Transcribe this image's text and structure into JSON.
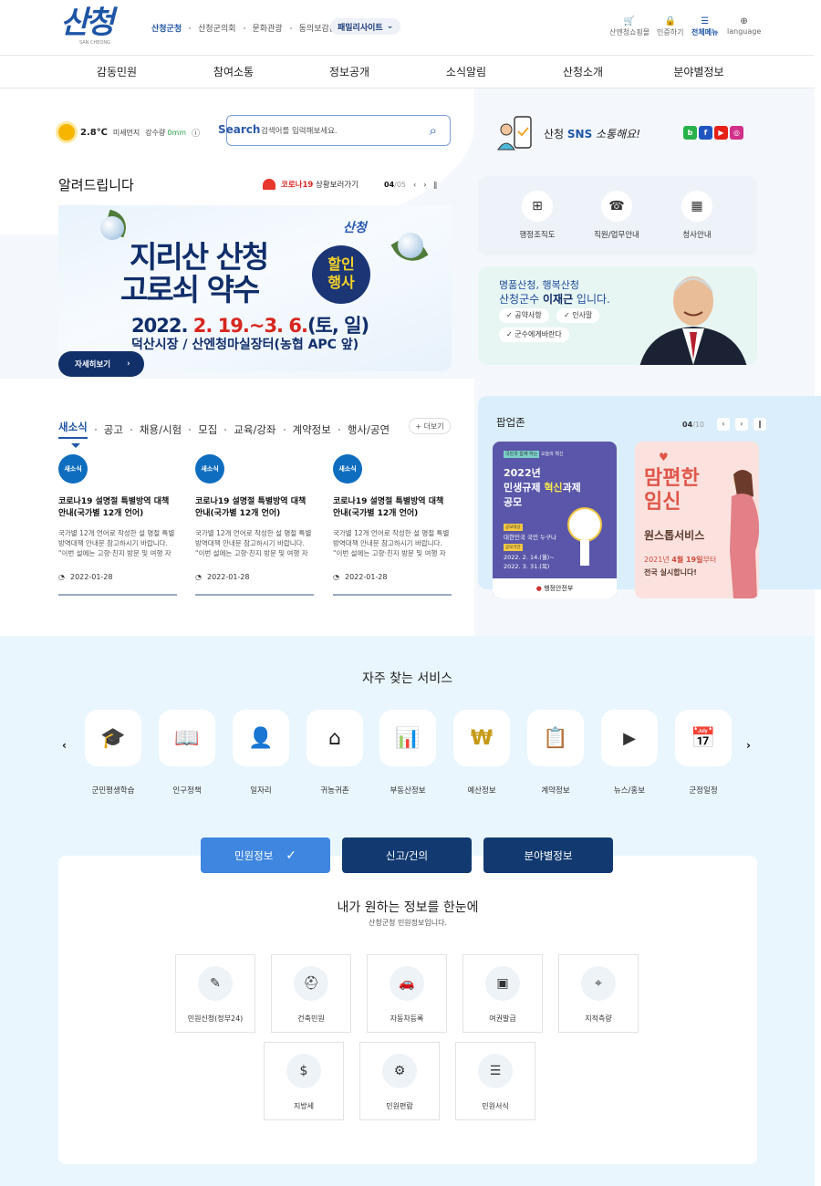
{
  "header": {
    "logo": "산청",
    "logo_sub": "SAN CHEONG",
    "toplinks": [
      "산청군청",
      "산청군의회",
      "문화관광",
      "동의보감촌"
    ],
    "family_site": "패밀리사이트",
    "util": [
      {
        "label": "산엔청쇼핑몰",
        "icon": "cart-icon"
      },
      {
        "label": "인증하기",
        "icon": "lock-icon"
      },
      {
        "label": "전체메뉴",
        "icon": "menu-icon"
      },
      {
        "label": "language",
        "icon": "globe-icon"
      }
    ]
  },
  "gnb": [
    "감동민원",
    "참여소통",
    "정보공개",
    "소식알림",
    "산청소개",
    "분야별정보"
  ],
  "weather": {
    "temp": "2.8℃",
    "dust": "미세먼지",
    "rain_label": "강수량",
    "rain": "0mm"
  },
  "search": {
    "label": "Search",
    "placeholder": "검색어를 입력해보세요."
  },
  "notice": {
    "title": "알려드립니다",
    "covid": "코로나19",
    "covid_rest": "상황보러가기",
    "page": "04",
    "total": "/05"
  },
  "banner": {
    "logo": "산청",
    "line1": "지리산 산청",
    "line2": "고로쇠 약수",
    "badge1": "할인",
    "badge2": "행사",
    "date_a": "2022. ",
    "date_b": "2. 19.~3. 6.",
    "date_c": "(토, 일)",
    "place": "덕산시장 / 산엔청마실장터(농협 APC 앞)",
    "more": "자세히보기"
  },
  "sns": {
    "text1": "산청 ",
    "text2": "SNS",
    "text3": " 소통해요!",
    "icons": [
      {
        "l": "b",
        "c": "#27b24a"
      },
      {
        "l": "f",
        "c": "#1f55c0"
      },
      {
        "l": "▶",
        "c": "#e62117"
      },
      {
        "l": "◎",
        "c": "#d1308a"
      }
    ]
  },
  "quick": [
    {
      "label": "행정조직도",
      "icon": "org-chart-icon",
      "g": "⊞"
    },
    {
      "label": "직원/업무안내",
      "icon": "phone-icon",
      "g": "☎"
    },
    {
      "label": "청사안내",
      "icon": "building-icon",
      "g": "▦"
    }
  ],
  "mayor": {
    "line1": "명품산청, 행복산청",
    "line2a": "산청군수 ",
    "line2b": "이재근",
    "line2c": " 입니다.",
    "btns": [
      "공약사항",
      "인사말",
      "군수에게바란다"
    ]
  },
  "news": {
    "tabs": [
      "새소식",
      "공고",
      "채용/시험",
      "모집",
      "교육/강좌",
      "계약정보",
      "행사/공연"
    ],
    "more": "+ 더보기",
    "cards": [
      {
        "badge": "새소식",
        "title": "코로나19 설명절 특별방역 대책 안내(국가별 12개 언어)",
        "body": "국가별 12개 언어로 작성한 설 명절 특별방역대책 안내문 참고하시기 바랍니다. \"이번 설에는 고향·친지 방문 및 여행 자제\"",
        "date": "2022-01-28"
      },
      {
        "badge": "새소식",
        "title": "코로나19 설명절 특별방역 대책 안내(국가별 12개 언어)",
        "body": "국가별 12개 언어로 작성한 설 명절 특별방역대책 안내문 참고하시기 바랍니다. \"이번 설에는 고향·친지 방문 및 여행 자제\"",
        "date": "2022-01-28"
      },
      {
        "badge": "새소식",
        "title": "코로나19 설명절 특별방역 대책 안내(국가별 12개 언어)",
        "body": "국가별 12개 언어로 작성한 설 명절 특별방역대책 안내문 참고하시기 바랍니다. \"이번 설에는 고향·친지 방문 및 여행 자제\"",
        "date": "2022-01-28"
      }
    ]
  },
  "popup": {
    "title": "팝업존",
    "page": "04",
    "total": "/10",
    "p1": {
      "tag": "국민과 함께 하는",
      "tag2": "오늘의 혁신",
      "year": "2022년",
      "l1": "민생규제 ",
      "l1b": "혁신",
      "l1c": "과제",
      "l2": "공모",
      "k1": "공모대상",
      "v1": "대한민국 국민 누구나",
      "k2": "공모기간",
      "v2": "2022. 2. 14.(월)~",
      "v3": "2022. 3. 31.(목)",
      "org": "행정안전부"
    },
    "p2": {
      "l1": "맘편한",
      "l2": "임신",
      "l3": "원스톱서비스",
      "l4a": "2021년 ",
      "l4b": "4월 19일",
      "l4c": "부터",
      "l5": "전국 실시합니다!"
    }
  },
  "services": {
    "title": "자주 찾는 서비스",
    "items": [
      {
        "label": "군민평생학습",
        "icon": "graduation-cap-icon",
        "g": "🎓"
      },
      {
        "label": "인구정책",
        "icon": "reading-person-icon",
        "g": "📖"
      },
      {
        "label": "일자리",
        "icon": "id-card-icon",
        "g": "👤"
      },
      {
        "label": "귀농귀촌",
        "icon": "house-icon",
        "g": "⌂"
      },
      {
        "label": "부동산정보",
        "icon": "monitor-chart-icon",
        "g": "📊"
      },
      {
        "label": "예산정보",
        "icon": "money-bag-icon",
        "g": "₩"
      },
      {
        "label": "계약정보",
        "icon": "contract-icon",
        "g": "📋"
      },
      {
        "label": "뉴스/홍보",
        "icon": "video-icon",
        "g": "▶"
      },
      {
        "label": "군정일정",
        "icon": "calendar-icon",
        "g": "📅"
      }
    ]
  },
  "info": {
    "tabs": [
      "민원정보",
      "신고/건의",
      "분야별정보"
    ],
    "title": "내가 원하는 정보를 한눈에",
    "sub": "산청군청 민원정보입니다.",
    "items": [
      {
        "label": "민원신청(정부24)",
        "icon": "application-icon",
        "g": "✎"
      },
      {
        "label": "건축민원",
        "icon": "worker-icon",
        "g": "⛑"
      },
      {
        "label": "자동차등록",
        "icon": "car-icon",
        "g": "🚗"
      },
      {
        "label": "여권발급",
        "icon": "passport-icon",
        "g": "▣"
      },
      {
        "label": "지적측량",
        "icon": "survey-icon",
        "g": "⌖"
      },
      {
        "label": "지방세",
        "icon": "tax-bag-icon",
        "g": "$"
      },
      {
        "label": "민원편람",
        "icon": "guide-icon",
        "g": "⚙"
      },
      {
        "label": "민원서식",
        "icon": "form-icon",
        "g": "☰"
      }
    ]
  },
  "colors": {
    "primary": "#1f55a6",
    "navy": "#11306a",
    "badge": "#0f6dc0",
    "tab_active": "#3f86e0",
    "tab_navy": "#123a70"
  }
}
